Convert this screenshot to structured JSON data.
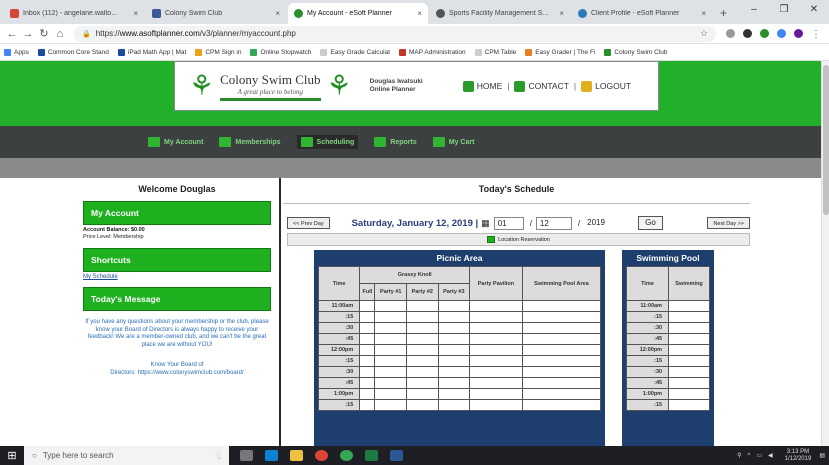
{
  "browser": {
    "tabs": [
      {
        "title": "Inbox (112) - angelane.walto...",
        "color": "#d44638"
      },
      {
        "title": "Colony Swim Club",
        "color": "#3b5998"
      },
      {
        "title": "My Account - eSoft Planner",
        "color": "#2a8f2a",
        "active": true
      },
      {
        "title": "Sports Facility Management S...",
        "color": "#555555"
      },
      {
        "title": "Client Profile - eSoft Planner",
        "color": "#2a7ab8"
      }
    ],
    "new_tab": "+",
    "url_prefix": "https://",
    "url_host": "www.asoftplanner.com",
    "url_path": "/v3/planner/myaccount.php",
    "bookmarks": [
      {
        "label": "Apps",
        "color": "#4285f4"
      },
      {
        "label": "Common Core Stand",
        "color": "#1a4d9b"
      },
      {
        "label": "iPad Math App | Mat",
        "color": "#1a4d9b"
      },
      {
        "label": "CPM Sign in",
        "color": "#e8a317"
      },
      {
        "label": "Online Stopwatch",
        "color": "#34a853"
      },
      {
        "label": "Easy Grade Calculat",
        "color": "#777777"
      },
      {
        "label": "MAP Administration",
        "color": "#c0392b"
      },
      {
        "label": "CPM Table",
        "color": "#777777"
      },
      {
        "label": "Easy Grader | The Fi",
        "color": "#e67e22"
      },
      {
        "label": "Colony Swim Club",
        "color": "#2a8f2a"
      }
    ]
  },
  "site": {
    "club_name": "Colony Swim Club",
    "club_tagline": "A great place to belong",
    "planner_line1": "Douglas Iwatsuki",
    "planner_line2": "Online Planner",
    "links": {
      "home": "HOME",
      "contact": "CONTACT",
      "logout": "LOGOUT"
    },
    "nav": [
      "My Account",
      "Memberships",
      "Scheduling",
      "Reports",
      "My Cart"
    ]
  },
  "left": {
    "welcome": "Welcome Douglas",
    "my_account": "My Account",
    "balance": "Account Balance: $0.00",
    "price_level": "Price Level: Membership",
    "shortcuts": "Shortcuts",
    "my_schedule": "My Schedule",
    "todays_message": "Today's Message",
    "message": "If you have any questions about your membership or the club, please know your Board of Directors is always happy to receive your feedback! We are a member-owned club, and we can't be the great place we are without YOU!",
    "board_line1": "Know Your Board of",
    "board_line2": "Directors: https://www.colonyswimclub.com/board/"
  },
  "schedule": {
    "title": "Today's Schedule",
    "prev": "<< Prev Day",
    "next": "Next Day >>",
    "date_text": "Saturday, January 12, 2019 |",
    "day": "01",
    "month": "12",
    "year": "2019",
    "go": "Go",
    "legend": "Location Reservation",
    "picnic": {
      "title": "Picnic Area",
      "h_time": "Time",
      "h_grassy": "Grassy Knoll",
      "h_full": "Full",
      "h_p1": "Party #1",
      "h_p2": "Party #2",
      "h_p3": "Party #3",
      "h_pavilion": "Party Pavilion",
      "h_pool_area": "Swimming Pool Area"
    },
    "pool": {
      "title": "Swimming Pool",
      "h_time": "Time",
      "h_swim": "Swimming"
    },
    "times": [
      "11:00am",
      ":15",
      ":30",
      ":45",
      "12:00pm",
      ":15",
      ":30",
      ":45",
      "1:00pm",
      ":15"
    ]
  },
  "taskbar": {
    "search": "Type here to search",
    "time": "3:13 PM",
    "date": "1/12/2019"
  }
}
